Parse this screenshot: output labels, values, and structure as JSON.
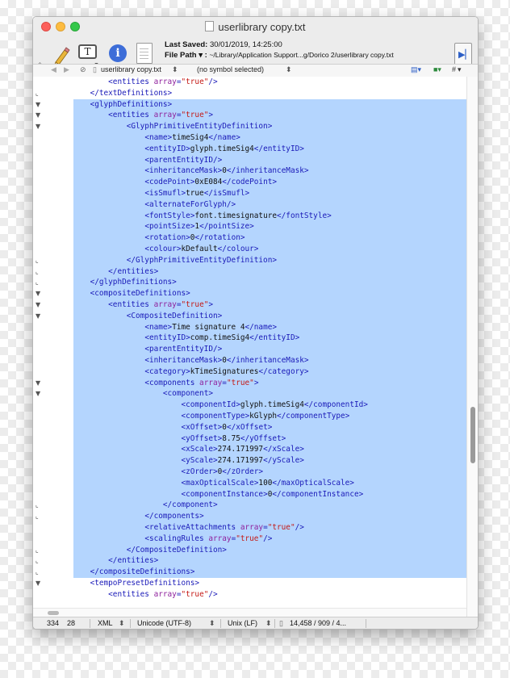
{
  "window": {
    "title": "userlibrary copy.txt"
  },
  "toolbar": {
    "last_saved_label": "Last Saved:",
    "last_saved_value": "30/01/2019, 14:25:00",
    "file_path_label": "File Path ▾ :",
    "file_path_value": "~/Library/Application Support...g/Dorico 2/userlibrary copy.txt",
    "text_tool_glyph": "T",
    "info_glyph": "i",
    "dropdown_glyph": "◇"
  },
  "navbar": {
    "back": "◀",
    "forward": "▶",
    "lock": "⊘",
    "file_name": "userlibrary copy.txt",
    "file_arrows": "⬍",
    "symbol": "(no symbol selected)",
    "symbol_arrows": "⬍",
    "hash": "#"
  },
  "editor": {
    "colors": {
      "tag": "#1a1ab8",
      "attribute_name": "#8e1f9c",
      "attribute_value": "#c41a16",
      "text": "#111111",
      "selection": "#b4d5fe"
    },
    "lines": [
      {
        "fold": "",
        "sel": false,
        "parts": [
          {
            "t": "        "
          },
          {
            "c": "tag",
            "t": "<entities "
          },
          {
            "c": "an",
            "t": "array"
          },
          {
            "c": "tag",
            "t": "="
          },
          {
            "c": "av",
            "t": "\"true\""
          },
          {
            "c": "tag",
            "t": "/>"
          }
        ]
      },
      {
        "fold": "⌞",
        "sel": false,
        "parts": [
          {
            "t": "    "
          },
          {
            "c": "tag",
            "t": "</textDefinitions>"
          }
        ]
      },
      {
        "fold": "▼",
        "sel": true,
        "parts": [
          {
            "t": "    "
          },
          {
            "c": "tag",
            "t": "<glyphDefinitions>"
          }
        ]
      },
      {
        "fold": "▼",
        "sel": true,
        "parts": [
          {
            "t": "        "
          },
          {
            "c": "tag",
            "t": "<entities "
          },
          {
            "c": "an",
            "t": "array"
          },
          {
            "c": "tag",
            "t": "="
          },
          {
            "c": "av",
            "t": "\"true\""
          },
          {
            "c": "tag",
            "t": ">"
          }
        ]
      },
      {
        "fold": "▼",
        "sel": true,
        "parts": [
          {
            "t": "            "
          },
          {
            "c": "tag",
            "t": "<GlyphPrimitiveEntityDefinition>"
          }
        ]
      },
      {
        "fold": "",
        "sel": true,
        "parts": [
          {
            "t": "                "
          },
          {
            "c": "tag",
            "t": "<name>"
          },
          {
            "c": "tx",
            "t": "timeSig4"
          },
          {
            "c": "tag",
            "t": "</name>"
          }
        ]
      },
      {
        "fold": "",
        "sel": true,
        "parts": [
          {
            "t": "                "
          },
          {
            "c": "tag",
            "t": "<entityID>"
          },
          {
            "c": "tx",
            "t": "glyph.timeSig4"
          },
          {
            "c": "tag",
            "t": "</entityID>"
          }
        ]
      },
      {
        "fold": "",
        "sel": true,
        "parts": [
          {
            "t": "                "
          },
          {
            "c": "tag",
            "t": "<parentEntityID/>"
          }
        ]
      },
      {
        "fold": "",
        "sel": true,
        "parts": [
          {
            "t": "                "
          },
          {
            "c": "tag",
            "t": "<inheritanceMask>"
          },
          {
            "c": "tx",
            "t": "0"
          },
          {
            "c": "tag",
            "t": "</inheritanceMask>"
          }
        ]
      },
      {
        "fold": "",
        "sel": true,
        "parts": [
          {
            "t": "                "
          },
          {
            "c": "tag",
            "t": "<codePoint>"
          },
          {
            "c": "tx",
            "t": "0xE084"
          },
          {
            "c": "tag",
            "t": "</codePoint>"
          }
        ]
      },
      {
        "fold": "",
        "sel": true,
        "parts": [
          {
            "t": "                "
          },
          {
            "c": "tag",
            "t": "<isSmufl>"
          },
          {
            "c": "tx",
            "t": "true"
          },
          {
            "c": "tag",
            "t": "</isSmufl>"
          }
        ]
      },
      {
        "fold": "",
        "sel": true,
        "parts": [
          {
            "t": "                "
          },
          {
            "c": "tag",
            "t": "<alternateForGlyph/>"
          }
        ]
      },
      {
        "fold": "",
        "sel": true,
        "parts": [
          {
            "t": "                "
          },
          {
            "c": "tag",
            "t": "<fontStyle>"
          },
          {
            "c": "tx",
            "t": "font.timesignature"
          },
          {
            "c": "tag",
            "t": "</fontStyle>"
          }
        ]
      },
      {
        "fold": "",
        "sel": true,
        "parts": [
          {
            "t": "                "
          },
          {
            "c": "tag",
            "t": "<pointSize>"
          },
          {
            "c": "tx",
            "t": "1"
          },
          {
            "c": "tag",
            "t": "</pointSize>"
          }
        ]
      },
      {
        "fold": "",
        "sel": true,
        "parts": [
          {
            "t": "                "
          },
          {
            "c": "tag",
            "t": "<rotation>"
          },
          {
            "c": "tx",
            "t": "0"
          },
          {
            "c": "tag",
            "t": "</rotation>"
          }
        ]
      },
      {
        "fold": "",
        "sel": true,
        "parts": [
          {
            "t": "                "
          },
          {
            "c": "tag",
            "t": "<colour>"
          },
          {
            "c": "tx",
            "t": "kDefault"
          },
          {
            "c": "tag",
            "t": "</colour>"
          }
        ]
      },
      {
        "fold": "⌞",
        "sel": true,
        "parts": [
          {
            "t": "            "
          },
          {
            "c": "tag",
            "t": "</GlyphPrimitiveEntityDefinition>"
          }
        ]
      },
      {
        "fold": "⌞",
        "sel": true,
        "parts": [
          {
            "t": "        "
          },
          {
            "c": "tag",
            "t": "</entities>"
          }
        ]
      },
      {
        "fold": "⌞",
        "sel": true,
        "parts": [
          {
            "t": "    "
          },
          {
            "c": "tag",
            "t": "</glyphDefinitions>"
          }
        ]
      },
      {
        "fold": "▼",
        "sel": true,
        "parts": [
          {
            "t": "    "
          },
          {
            "c": "tag",
            "t": "<compositeDefinitions>"
          }
        ]
      },
      {
        "fold": "▼",
        "sel": true,
        "parts": [
          {
            "t": "        "
          },
          {
            "c": "tag",
            "t": "<entities "
          },
          {
            "c": "an",
            "t": "array"
          },
          {
            "c": "tag",
            "t": "="
          },
          {
            "c": "av",
            "t": "\"true\""
          },
          {
            "c": "tag",
            "t": ">"
          }
        ]
      },
      {
        "fold": "▼",
        "sel": true,
        "parts": [
          {
            "t": "            "
          },
          {
            "c": "tag",
            "t": "<CompositeDefinition>"
          }
        ]
      },
      {
        "fold": "",
        "sel": true,
        "parts": [
          {
            "t": "                "
          },
          {
            "c": "tag",
            "t": "<name>"
          },
          {
            "c": "tx",
            "t": "Time signature 4"
          },
          {
            "c": "tag",
            "t": "</name>"
          }
        ]
      },
      {
        "fold": "",
        "sel": true,
        "parts": [
          {
            "t": "                "
          },
          {
            "c": "tag",
            "t": "<entityID>"
          },
          {
            "c": "tx",
            "t": "comp.timeSig4"
          },
          {
            "c": "tag",
            "t": "</entityID>"
          }
        ]
      },
      {
        "fold": "",
        "sel": true,
        "parts": [
          {
            "t": "                "
          },
          {
            "c": "tag",
            "t": "<parentEntityID/>"
          }
        ]
      },
      {
        "fold": "",
        "sel": true,
        "parts": [
          {
            "t": "                "
          },
          {
            "c": "tag",
            "t": "<inheritanceMask>"
          },
          {
            "c": "tx",
            "t": "0"
          },
          {
            "c": "tag",
            "t": "</inheritanceMask>"
          }
        ]
      },
      {
        "fold": "",
        "sel": true,
        "parts": [
          {
            "t": "                "
          },
          {
            "c": "tag",
            "t": "<category>"
          },
          {
            "c": "tx",
            "t": "kTimeSignatures"
          },
          {
            "c": "tag",
            "t": "</category>"
          }
        ]
      },
      {
        "fold": "▼",
        "sel": true,
        "parts": [
          {
            "t": "                "
          },
          {
            "c": "tag",
            "t": "<components "
          },
          {
            "c": "an",
            "t": "array"
          },
          {
            "c": "tag",
            "t": "="
          },
          {
            "c": "av",
            "t": "\"true\""
          },
          {
            "c": "tag",
            "t": ">"
          }
        ]
      },
      {
        "fold": "▼",
        "sel": true,
        "parts": [
          {
            "t": "                    "
          },
          {
            "c": "tag",
            "t": "<component>"
          }
        ]
      },
      {
        "fold": "",
        "sel": true,
        "parts": [
          {
            "t": "                        "
          },
          {
            "c": "tag",
            "t": "<componentId>"
          },
          {
            "c": "tx",
            "t": "glyph.timeSig4"
          },
          {
            "c": "tag",
            "t": "</componentId>"
          }
        ]
      },
      {
        "fold": "",
        "sel": true,
        "parts": [
          {
            "t": "                        "
          },
          {
            "c": "tag",
            "t": "<componentType>"
          },
          {
            "c": "tx",
            "t": "kGlyph"
          },
          {
            "c": "tag",
            "t": "</componentType>"
          }
        ]
      },
      {
        "fold": "",
        "sel": true,
        "parts": [
          {
            "t": "                        "
          },
          {
            "c": "tag",
            "t": "<xOffset>"
          },
          {
            "c": "tx",
            "t": "0"
          },
          {
            "c": "tag",
            "t": "</xOffset>"
          }
        ]
      },
      {
        "fold": "",
        "sel": true,
        "parts": [
          {
            "t": "                        "
          },
          {
            "c": "tag",
            "t": "<yOffset>"
          },
          {
            "c": "tx",
            "t": "8.75"
          },
          {
            "c": "tag",
            "t": "</yOffset>"
          }
        ]
      },
      {
        "fold": "",
        "sel": true,
        "parts": [
          {
            "t": "                        "
          },
          {
            "c": "tag",
            "t": "<xScale>"
          },
          {
            "c": "tx",
            "t": "274.171997"
          },
          {
            "c": "tag",
            "t": "</xScale>"
          }
        ]
      },
      {
        "fold": "",
        "sel": true,
        "parts": [
          {
            "t": "                        "
          },
          {
            "c": "tag",
            "t": "<yScale>"
          },
          {
            "c": "tx",
            "t": "274.171997"
          },
          {
            "c": "tag",
            "t": "</yScale>"
          }
        ]
      },
      {
        "fold": "",
        "sel": true,
        "parts": [
          {
            "t": "                        "
          },
          {
            "c": "tag",
            "t": "<zOrder>"
          },
          {
            "c": "tx",
            "t": "0"
          },
          {
            "c": "tag",
            "t": "</zOrder>"
          }
        ]
      },
      {
        "fold": "",
        "sel": true,
        "parts": [
          {
            "t": "                        "
          },
          {
            "c": "tag",
            "t": "<maxOpticalScale>"
          },
          {
            "c": "tx",
            "t": "100"
          },
          {
            "c": "tag",
            "t": "</maxOpticalScale>"
          }
        ]
      },
      {
        "fold": "",
        "sel": true,
        "parts": [
          {
            "t": "                        "
          },
          {
            "c": "tag",
            "t": "<componentInstance>"
          },
          {
            "c": "tx",
            "t": "0"
          },
          {
            "c": "tag",
            "t": "</componentInstance>"
          }
        ]
      },
      {
        "fold": "⌞",
        "sel": true,
        "parts": [
          {
            "t": "                    "
          },
          {
            "c": "tag",
            "t": "</component>"
          }
        ]
      },
      {
        "fold": "⌞",
        "sel": true,
        "parts": [
          {
            "t": "                "
          },
          {
            "c": "tag",
            "t": "</components>"
          }
        ]
      },
      {
        "fold": "",
        "sel": true,
        "parts": [
          {
            "t": "                "
          },
          {
            "c": "tag",
            "t": "<relativeAttachments "
          },
          {
            "c": "an",
            "t": "array"
          },
          {
            "c": "tag",
            "t": "="
          },
          {
            "c": "av",
            "t": "\"true\""
          },
          {
            "c": "tag",
            "t": "/>"
          }
        ]
      },
      {
        "fold": "",
        "sel": true,
        "parts": [
          {
            "t": "                "
          },
          {
            "c": "tag",
            "t": "<scalingRules "
          },
          {
            "c": "an",
            "t": "array"
          },
          {
            "c": "tag",
            "t": "="
          },
          {
            "c": "av",
            "t": "\"true\""
          },
          {
            "c": "tag",
            "t": "/>"
          }
        ]
      },
      {
        "fold": "⌞",
        "sel": true,
        "parts": [
          {
            "t": "            "
          },
          {
            "c": "tag",
            "t": "</CompositeDefinition>"
          }
        ]
      },
      {
        "fold": "⌞",
        "sel": true,
        "parts": [
          {
            "t": "        "
          },
          {
            "c": "tag",
            "t": "</entities>"
          }
        ]
      },
      {
        "fold": "⌞",
        "sel": true,
        "parts": [
          {
            "t": "    "
          },
          {
            "c": "tag",
            "t": "</compositeDefinitions>"
          }
        ]
      },
      {
        "fold": "▼",
        "sel": false,
        "parts": [
          {
            "t": "    "
          },
          {
            "c": "tag",
            "t": "<tempoPresetDefinitions>"
          }
        ]
      },
      {
        "fold": "",
        "sel": false,
        "parts": [
          {
            "t": "        "
          },
          {
            "c": "tag",
            "t": "<entities "
          },
          {
            "c": "an",
            "t": "array"
          },
          {
            "c": "tag",
            "t": "="
          },
          {
            "c": "av",
            "t": "\"true\""
          },
          {
            "c": "tag",
            "t": "/>"
          }
        ]
      }
    ]
  },
  "statusbar": {
    "line": "334",
    "column": "28",
    "syntax": "XML",
    "syntax_arrows": "⬍",
    "encoding": "Unicode (UTF-8)",
    "encoding_arrows": "⬍",
    "line_endings": "Unix (LF)",
    "line_endings_arrows": "⬍",
    "doc_stats": "14,458 / 909 / 4..."
  }
}
